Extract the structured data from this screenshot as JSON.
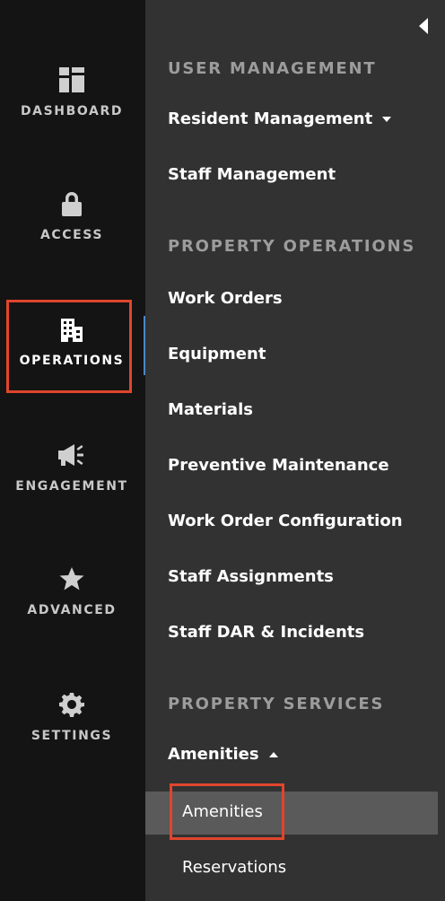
{
  "rail": {
    "items": [
      {
        "label": "DASHBOARD",
        "icon": "dashboard-icon"
      },
      {
        "label": "ACCESS",
        "icon": "lock-icon"
      },
      {
        "label": "OPERATIONS",
        "icon": "building-icon",
        "active": true
      },
      {
        "label": "ENGAGEMENT",
        "icon": "megaphone-icon"
      },
      {
        "label": "ADVANCED",
        "icon": "star-icon"
      },
      {
        "label": "SETTINGS",
        "icon": "gear-icon"
      }
    ]
  },
  "panel": {
    "sections": [
      {
        "header": "USER MANAGEMENT",
        "items": [
          {
            "label": "Resident Management",
            "expandable": true,
            "expanded": false
          },
          {
            "label": "Staff Management"
          }
        ]
      },
      {
        "header": "PROPERTY OPERATIONS",
        "items": [
          {
            "label": "Work Orders"
          },
          {
            "label": "Equipment"
          },
          {
            "label": "Materials"
          },
          {
            "label": "Preventive Maintenance"
          },
          {
            "label": "Work Order Configuration"
          },
          {
            "label": "Staff Assignments"
          },
          {
            "label": "Staff DAR & Incidents"
          }
        ]
      },
      {
        "header": "PROPERTY SERVICES",
        "items": [
          {
            "label": "Amenities",
            "expandable": true,
            "expanded": true,
            "children": [
              {
                "label": "Amenities",
                "active": true
              },
              {
                "label": "Reservations"
              }
            ]
          }
        ]
      }
    ]
  },
  "colors": {
    "rail_bg": "#141414",
    "panel_bg": "#323232",
    "highlight_border": "#e0452c",
    "active_indicator": "#4a88c8",
    "active_row_bg": "#5a5a5a"
  }
}
